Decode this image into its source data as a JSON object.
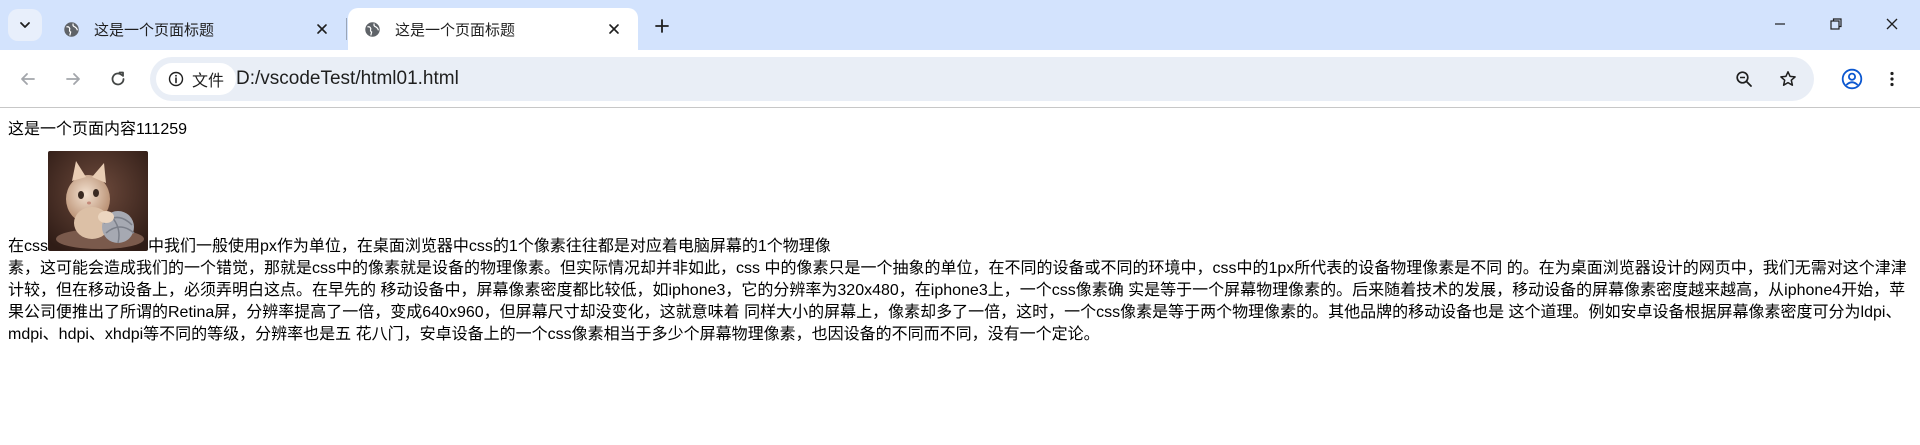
{
  "browser": {
    "tabs": [
      {
        "title": "这是一个页面标题",
        "active": false
      },
      {
        "title": "这是一个页面标题",
        "active": true
      }
    ],
    "address": {
      "security_label": "文件",
      "url": "D:/vscodeTest/html01.html"
    },
    "accent_color": "#d3e3fd"
  },
  "page": {
    "heading_text": "这是一个页面内容111259",
    "para_prefix": "在css",
    "para_after_image": "中我们一般使用px作为单位，在桌面浏览器中css的1个像素往往都是对应着电脑屏幕的1个物理像",
    "para_rest": "素，这可能会造成我们的一个错觉，那就是css中的像素就是设备的物理像素。但实际情况却并非如此，css 中的像素只是一个抽象的单位，在不同的设备或不同的环境中，css中的1px所代表的设备物理像素是不同 的。在为桌面浏览器设计的网页中，我们无需对这个津津计较，但在移动设备上，必须弄明白这点。在早先的 移动设备中，屏幕像素密度都比较低，如iphone3，它的分辨率为320x480，在iphone3上，一个css像素确 实是等于一个屏幕物理像素的。后来随着技术的发展，移动设备的屏幕像素密度越来越高，从iphone4开始，苹果公司便推出了所谓的Retina屏，分辨率提高了一倍，变成640x960，但屏幕尺寸却没变化，这就意味着 同样大小的屏幕上，像素却多了一倍，这时，一个css像素是等于两个物理像素的。其他品牌的移动设备也是 这个道理。例如安卓设备根据屏幕像素密度可分为ldpi、mdpi、hdpi、xhdpi等不同的等级，分辨率也是五 花八门，安卓设备上的一个css像素相当于多少个屏幕物理像素，也因设备的不同而不同，没有一个定论。"
  }
}
